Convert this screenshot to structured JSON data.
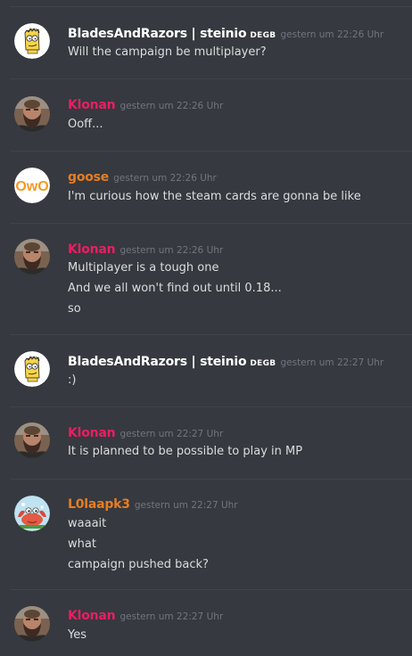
{
  "colors": {
    "background": "#36393f",
    "divider": "#40444b",
    "text": "#dcddde",
    "timestamp": "#72767d",
    "role_white": "#ffffff",
    "role_red": "#e91e63",
    "role_orange": "#e67e22"
  },
  "messages": [
    {
      "author": "BladesAndRazors | steinio",
      "tag": "DEGB",
      "timestamp": "gestern um 22:26 Uhr",
      "avatar_icon": "simpson-avatar-icon",
      "name_color": "#ffffff",
      "lines": [
        "Will the campaign be multiplayer?"
      ]
    },
    {
      "author": "Klonan",
      "timestamp": "gestern um 22:26 Uhr",
      "avatar_icon": "bearded-man-avatar-icon",
      "name_color": "#e91e63",
      "lines": [
        "Ooff..."
      ]
    },
    {
      "author": "goose",
      "timestamp": "gestern um 22:26 Uhr",
      "avatar_icon": "owo-face-avatar-icon",
      "avatar_text": "OwO",
      "name_color": "#e67e22",
      "lines": [
        "I'm curious how the steam cards are gonna be like"
      ]
    },
    {
      "author": "Klonan",
      "timestamp": "gestern um 22:26 Uhr",
      "avatar_icon": "bearded-man-avatar-icon",
      "name_color": "#e91e63",
      "lines": [
        "Multiplayer is a tough one",
        "And we all won't find out until 0.18...",
        "so"
      ]
    },
    {
      "author": "BladesAndRazors | steinio",
      "tag": "DEGB",
      "timestamp": "gestern um 22:27 Uhr",
      "avatar_icon": "simpson-avatar-icon",
      "name_color": "#ffffff",
      "lines": [
        ":)"
      ]
    },
    {
      "author": "Klonan",
      "timestamp": "gestern um 22:27 Uhr",
      "avatar_icon": "bearded-man-avatar-icon",
      "name_color": "#e91e63",
      "lines": [
        "It is planned to be possible to play in MP"
      ]
    },
    {
      "author": "L0laapk3",
      "timestamp": "gestern um 22:27 Uhr",
      "avatar_icon": "cartoon-crab-avatar-icon",
      "name_color": "#e67e22",
      "lines": [
        "waaait",
        "what",
        "campaign pushed back?"
      ]
    },
    {
      "author": "Klonan",
      "timestamp": "gestern um 22:27 Uhr",
      "avatar_icon": "bearded-man-avatar-icon",
      "name_color": "#e91e63",
      "lines": [
        "Yes"
      ]
    }
  ]
}
